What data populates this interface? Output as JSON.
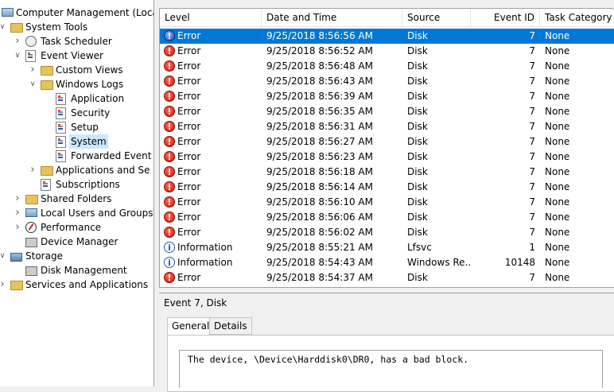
{
  "tree": [
    {
      "label": "Computer Management (Local",
      "icon": "computer-icon",
      "depth": 0,
      "expand": "none"
    },
    {
      "label": "System Tools",
      "icon": "tools-icon",
      "depth": 1,
      "expand": "expanded"
    },
    {
      "label": "Task Scheduler",
      "icon": "clock-icon",
      "depth": 2,
      "expand": "collapsed"
    },
    {
      "label": "Event Viewer",
      "icon": "event-viewer-icon",
      "depth": 2,
      "expand": "expanded"
    },
    {
      "label": "Custom Views",
      "icon": "folder-icon",
      "depth": 3,
      "expand": "collapsed"
    },
    {
      "label": "Windows Logs",
      "icon": "folder-icon",
      "depth": 3,
      "expand": "expanded"
    },
    {
      "label": "Application",
      "icon": "log-icon",
      "depth": 4,
      "expand": "none"
    },
    {
      "label": "Security",
      "icon": "log-icon",
      "depth": 4,
      "expand": "none"
    },
    {
      "label": "Setup",
      "icon": "log-icon",
      "depth": 4,
      "expand": "none"
    },
    {
      "label": "System",
      "icon": "log-icon",
      "depth": 4,
      "expand": "none",
      "selected": true
    },
    {
      "label": "Forwarded Event",
      "icon": "log-icon",
      "depth": 4,
      "expand": "none"
    },
    {
      "label": "Applications and Se",
      "icon": "folder-icon",
      "depth": 3,
      "expand": "collapsed"
    },
    {
      "label": "Subscriptions",
      "icon": "log-icon",
      "depth": 3,
      "expand": "none"
    },
    {
      "label": "Shared Folders",
      "icon": "shared-folder-icon",
      "depth": 2,
      "expand": "collapsed"
    },
    {
      "label": "Local Users and Groups",
      "icon": "users-icon",
      "depth": 2,
      "expand": "collapsed"
    },
    {
      "label": "Performance",
      "icon": "performance-icon",
      "depth": 2,
      "expand": "collapsed"
    },
    {
      "label": "Device Manager",
      "icon": "device-manager-icon",
      "depth": 2,
      "expand": "none"
    },
    {
      "label": "Storage",
      "icon": "storage-icon",
      "depth": 1,
      "expand": "expanded"
    },
    {
      "label": "Disk Management",
      "icon": "disk-icon",
      "depth": 2,
      "expand": "none"
    },
    {
      "label": "Services and Applications",
      "icon": "services-icon",
      "depth": 1,
      "expand": "collapsed"
    }
  ],
  "columns": {
    "level": "Level",
    "date": "Date and Time",
    "source": "Source",
    "event_id": "Event ID",
    "category": "Task Category"
  },
  "events": [
    {
      "level": "Error",
      "date": "9/25/2018 8:56:56 AM",
      "source": "Disk",
      "event_id": "7",
      "category": "None",
      "selected": true
    },
    {
      "level": "Error",
      "date": "9/25/2018 8:56:52 AM",
      "source": "Disk",
      "event_id": "7",
      "category": "None"
    },
    {
      "level": "Error",
      "date": "9/25/2018 8:56:48 AM",
      "source": "Disk",
      "event_id": "7",
      "category": "None"
    },
    {
      "level": "Error",
      "date": "9/25/2018 8:56:43 AM",
      "source": "Disk",
      "event_id": "7",
      "category": "None"
    },
    {
      "level": "Error",
      "date": "9/25/2018 8:56:39 AM",
      "source": "Disk",
      "event_id": "7",
      "category": "None"
    },
    {
      "level": "Error",
      "date": "9/25/2018 8:56:35 AM",
      "source": "Disk",
      "event_id": "7",
      "category": "None"
    },
    {
      "level": "Error",
      "date": "9/25/2018 8:56:31 AM",
      "source": "Disk",
      "event_id": "7",
      "category": "None"
    },
    {
      "level": "Error",
      "date": "9/25/2018 8:56:27 AM",
      "source": "Disk",
      "event_id": "7",
      "category": "None"
    },
    {
      "level": "Error",
      "date": "9/25/2018 8:56:23 AM",
      "source": "Disk",
      "event_id": "7",
      "category": "None"
    },
    {
      "level": "Error",
      "date": "9/25/2018 8:56:18 AM",
      "source": "Disk",
      "event_id": "7",
      "category": "None"
    },
    {
      "level": "Error",
      "date": "9/25/2018 8:56:14 AM",
      "source": "Disk",
      "event_id": "7",
      "category": "None"
    },
    {
      "level": "Error",
      "date": "9/25/2018 8:56:10 AM",
      "source": "Disk",
      "event_id": "7",
      "category": "None"
    },
    {
      "level": "Error",
      "date": "9/25/2018 8:56:06 AM",
      "source": "Disk",
      "event_id": "7",
      "category": "None"
    },
    {
      "level": "Error",
      "date": "9/25/2018 8:56:02 AM",
      "source": "Disk",
      "event_id": "7",
      "category": "None"
    },
    {
      "level": "Information",
      "date": "9/25/2018 8:55:21 AM",
      "source": "Lfsvc",
      "event_id": "1",
      "category": "None"
    },
    {
      "level": "Information",
      "date": "9/25/2018 8:54:43 AM",
      "source": "Windows Re...",
      "event_id": "10148",
      "category": "None"
    },
    {
      "level": "Error",
      "date": "9/25/2018 8:54:37 AM",
      "source": "Disk",
      "event_id": "7",
      "category": "None"
    }
  ],
  "detail": {
    "title": "Event 7, Disk",
    "tabs": [
      "General",
      "Details"
    ],
    "active_tab": "General",
    "description": "The device, \\Device\\Harddisk0\\DR0, has a bad block."
  },
  "colors": {
    "selection": "#0078d7",
    "tree_selection": "#cce8ff",
    "error": "#c8180b",
    "info": "#1f5fb0"
  }
}
